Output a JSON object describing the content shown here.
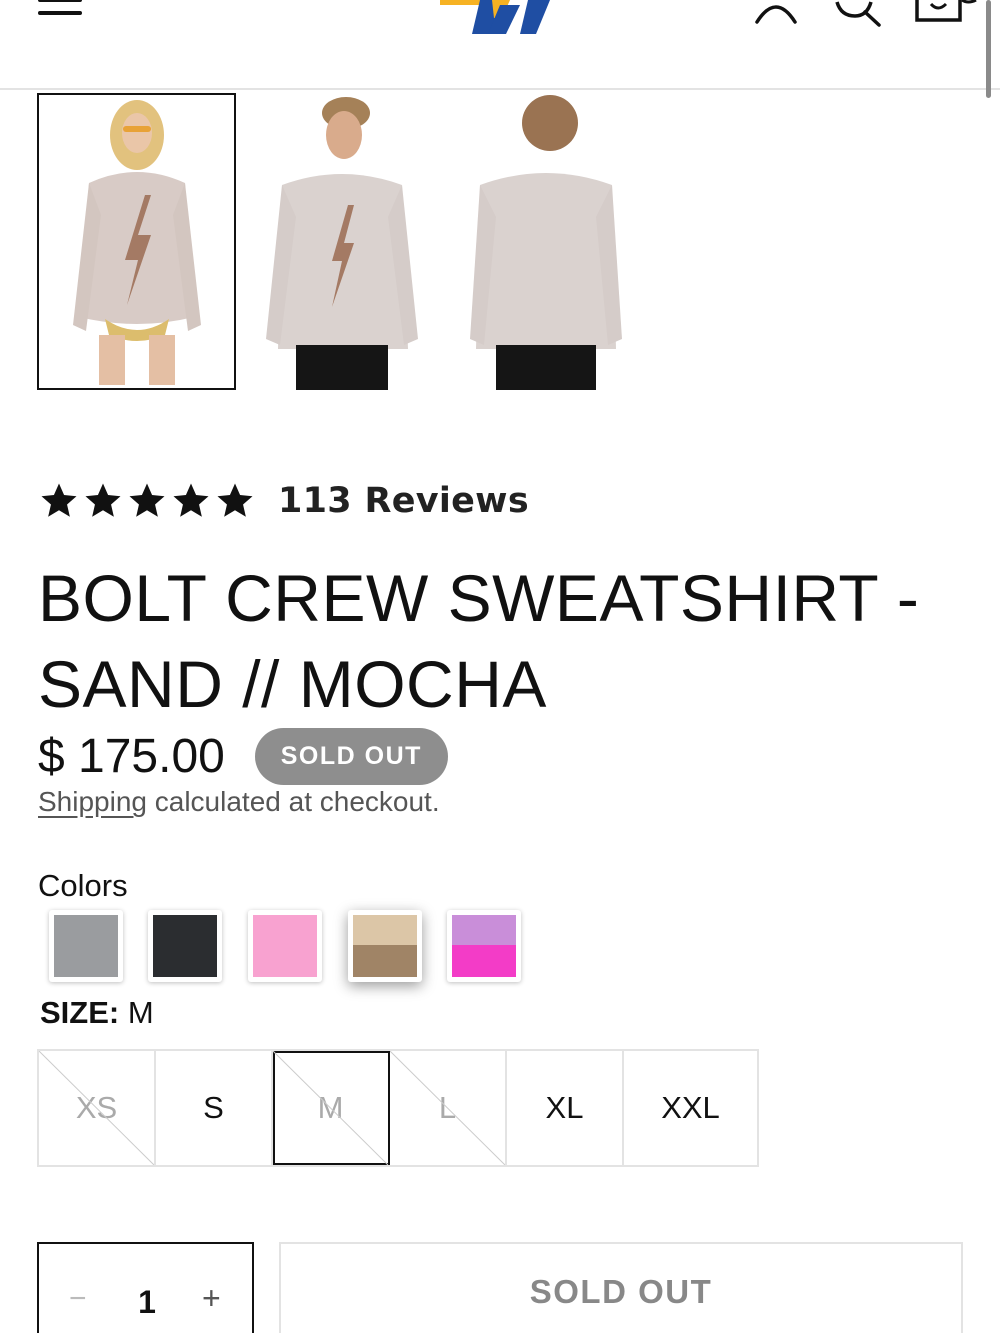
{
  "header": {
    "menu_icon": "hamburger-icon",
    "logo_icon": "brand-logo",
    "account_icon": "account-icon",
    "search_icon": "search-icon",
    "cart_icon": "cart-icon"
  },
  "gallery": {
    "thumbnails": [
      {
        "alt": "Model wearing sweatshirt - front",
        "selected": true
      },
      {
        "alt": "Male model - front",
        "selected": false
      },
      {
        "alt": "Male model - back",
        "selected": false
      }
    ]
  },
  "product": {
    "rating_stars": 5,
    "reviews_label": "113 Reviews",
    "title": "BOLT CREW SWEATSHIRT - SAND // MOCHA",
    "price": "$ 175.00",
    "badge": "SOLD OUT",
    "shipping_link": "Shipping",
    "shipping_text": " calculated at checkout."
  },
  "colors": {
    "label": "Colors",
    "swatches": [
      {
        "name": "heather-grey",
        "top": "#9a9c9f",
        "bottom": "#9a9c9f"
      },
      {
        "name": "charcoal",
        "top": "#2b2d30",
        "bottom": "#2b2d30"
      },
      {
        "name": "pink",
        "top": "#f8a2d0",
        "bottom": "#f8a2d0"
      },
      {
        "name": "sand-mocha",
        "top": "#dcc6a7",
        "bottom": "#a08466",
        "active": true
      },
      {
        "name": "lavender-pink",
        "top": "#c98ed9",
        "bottom": "#f33cc7"
      }
    ]
  },
  "size": {
    "label": "SIZE:",
    "value": "M",
    "options": [
      {
        "label": "XS",
        "available": false,
        "selected": false
      },
      {
        "label": "S",
        "available": true,
        "selected": false
      },
      {
        "label": "M",
        "available": false,
        "selected": true
      },
      {
        "label": "L",
        "available": false,
        "selected": false
      },
      {
        "label": "XL",
        "available": true,
        "selected": false
      },
      {
        "label": "XXL",
        "available": true,
        "selected": false
      }
    ]
  },
  "cart": {
    "quantity": "1",
    "minus": "−",
    "plus": "+",
    "button_label": "SOLD OUT"
  }
}
